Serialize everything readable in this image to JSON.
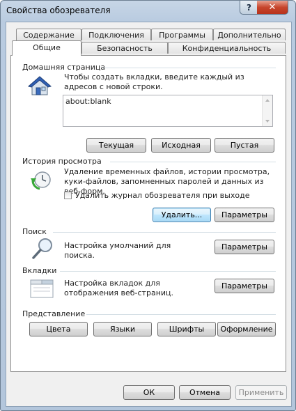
{
  "window": {
    "title": "Свойства обозревателя",
    "help_glyph": "?",
    "close_glyph": "✕"
  },
  "tabs": {
    "row_top": [
      "Содержание",
      "Подключения",
      "Программы",
      "Дополнительно"
    ],
    "row_bottom": [
      "Общие",
      "Безопасность",
      "Конфиденциальность"
    ],
    "active": "Общие"
  },
  "home": {
    "group_label": "Домашняя страница",
    "description": "Чтобы создать вкладки, введите каждый из адресов с новой строки.",
    "address": "about:blank",
    "btn_current": "Текущая",
    "btn_default": "Исходная",
    "btn_blank": "Пустая"
  },
  "history": {
    "group_label": "История просмотра",
    "description": "Удаление временных файлов, истории просмотра, куки-файлов, запомненных паролей и данных из веб-форм.",
    "checkbox_label": "Удалить журнал обозревателя при выходе",
    "checkbox_checked": false,
    "btn_delete": "Удалить...",
    "btn_settings": "Параметры"
  },
  "search": {
    "group_label": "Поиск",
    "description": "Настройка умолчаний для поиска.",
    "btn_settings": "Параметры"
  },
  "tabs_group": {
    "group_label": "Вкладки",
    "description": "Настройка вкладок для отображения веб-страниц.",
    "btn_settings": "Параметры"
  },
  "appearance": {
    "group_label": "Представление",
    "btn_colors": "Цвета",
    "btn_languages": "Языки",
    "btn_fonts": "Шрифты",
    "btn_accessibility": "Оформление"
  },
  "footer": {
    "ok": "ОК",
    "cancel": "Отмена",
    "apply": "Применить"
  },
  "icons": {
    "home": "house-icon",
    "history": "clock-refresh-icon",
    "search": "magnifier-icon",
    "tabs": "tabs-window-icon"
  }
}
